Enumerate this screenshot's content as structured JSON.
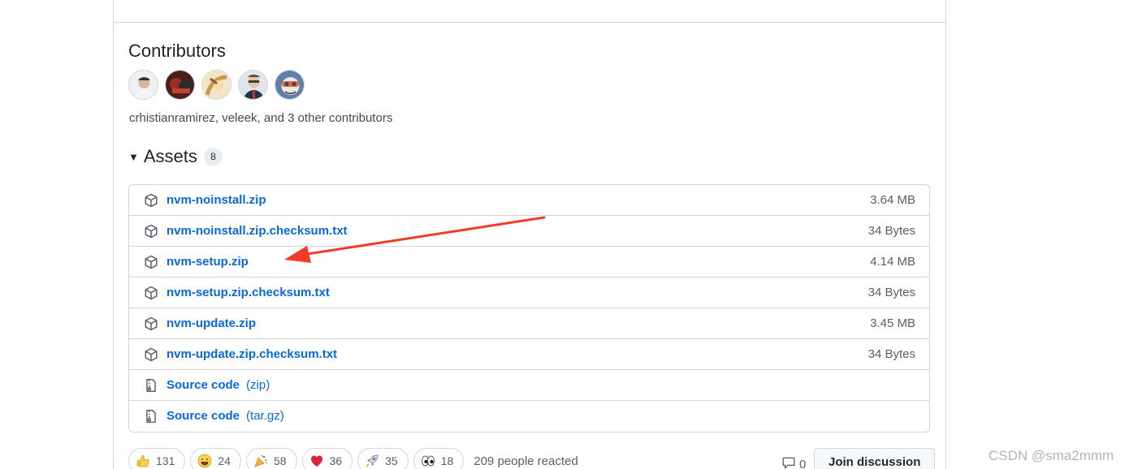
{
  "contributors": {
    "title": "Contributors",
    "avatars": [
      "crhistianramirez",
      "veleek",
      "contributor-3",
      "contributor-4",
      "contributor-5"
    ],
    "summary": "crhistianramirez, veleek, and 3 other contributors"
  },
  "assets": {
    "title": "Assets",
    "count": "8",
    "items": [
      {
        "name": "nvm-noinstall.zip",
        "size": "3.64 MB",
        "icon": "package-icon"
      },
      {
        "name": "nvm-noinstall.zip.checksum.txt",
        "size": "34 Bytes",
        "icon": "package-icon"
      },
      {
        "name": "nvm-setup.zip",
        "size": "4.14 MB",
        "icon": "package-icon"
      },
      {
        "name": "nvm-setup.zip.checksum.txt",
        "size": "34 Bytes",
        "icon": "package-icon"
      },
      {
        "name": "nvm-update.zip",
        "size": "3.45 MB",
        "icon": "package-icon"
      },
      {
        "name": "nvm-update.zip.checksum.txt",
        "size": "34 Bytes",
        "icon": "package-icon"
      },
      {
        "name": "Source code",
        "suffix": "(zip)",
        "icon": "file-zip-icon"
      },
      {
        "name": "Source code",
        "suffix": "(tar.gz)",
        "icon": "file-zip-icon"
      }
    ]
  },
  "reactions": {
    "items": [
      {
        "emoji": "thumbs-up",
        "count": "131"
      },
      {
        "emoji": "laugh",
        "count": "24"
      },
      {
        "emoji": "hooray",
        "count": "58"
      },
      {
        "emoji": "heart",
        "count": "36"
      },
      {
        "emoji": "rocket",
        "count": "35"
      },
      {
        "emoji": "eyes",
        "count": "18"
      }
    ],
    "summary": "209 people reacted"
  },
  "discussion": {
    "comment_count": "0",
    "join_label": "Join discussion"
  },
  "watermark": "CSDN @sma2mmm",
  "colors": {
    "link": "#0969da",
    "border": "#d0d7de",
    "annotation_arrow": "#f23a2a"
  }
}
